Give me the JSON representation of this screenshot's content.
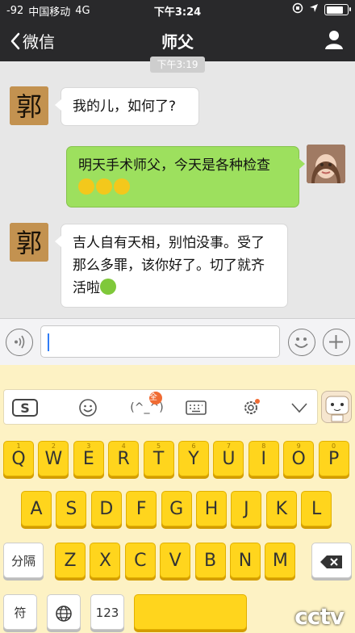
{
  "status": {
    "signal": "-92",
    "carrier": "中国移动",
    "network": "4G",
    "time": "下午3:24",
    "battery_level": 0.85
  },
  "nav": {
    "back_label": "微信",
    "title": "师父"
  },
  "chat": {
    "timestamp": "下午3:19",
    "messages": [
      {
        "from": "other",
        "avatar": "guo-avatar",
        "text": "我的儿，如何了?"
      },
      {
        "from": "me",
        "avatar": "girl-avatar",
        "text": "明天手术师父，今天是各种检查"
      },
      {
        "from": "other",
        "avatar": "guo-avatar",
        "text": "吉人自有天相，别怕没事。受了那么多罪，该你好了。切了就齐活啦"
      }
    ]
  },
  "keyboard": {
    "toolbar": {
      "emoticon": "(^_^)",
      "badge": "全"
    },
    "row1": [
      "Q",
      "W",
      "E",
      "R",
      "T",
      "Y",
      "U",
      "I",
      "O",
      "P"
    ],
    "row1_sub": [
      "1",
      "2",
      "3",
      "4",
      "5",
      "6",
      "7",
      "8",
      "9",
      "0"
    ],
    "row2": [
      "A",
      "S",
      "D",
      "F",
      "G",
      "H",
      "J",
      "K",
      "L"
    ],
    "row3": [
      "Z",
      "X",
      "C",
      "V",
      "B",
      "N",
      "M"
    ],
    "split_key": "分隔",
    "symbol_key": "符",
    "number_key": "123"
  },
  "watermark": "cctv"
}
